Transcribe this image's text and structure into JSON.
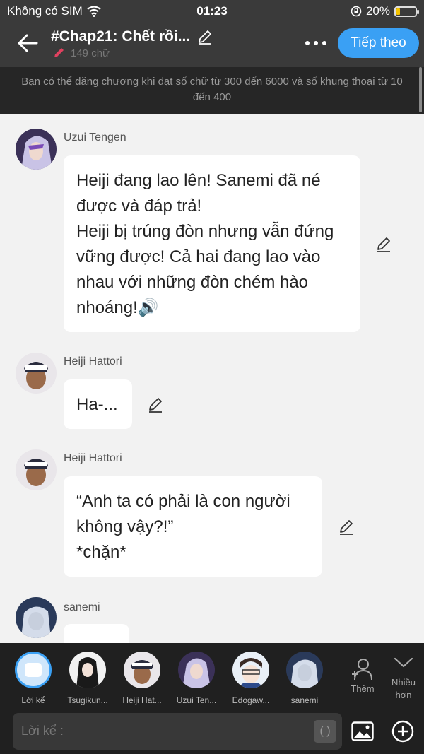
{
  "status_bar": {
    "carrier": "Không có SIM",
    "time": "01:23",
    "battery": "20%",
    "battery_level": 0.2
  },
  "header": {
    "title": "#Chap21: Chết rồi...",
    "word_count": "149 chữ",
    "next_label": "Tiếp theo"
  },
  "notice": "Bạn có thể đăng chương khi đạt số chữ từ 300 đến 6000 và số khung thoại từ 10 đến 400",
  "messages": [
    {
      "name": "Uzui Tengen",
      "text": "Heiji đang lao lên! Sanemi đã né được và đáp trả!\nHeiji bị trúng đòn nhưng vẫn đứng vững được! Cả hai đang lao vào nhau với những đòn chém hào nhoáng!🔊"
    },
    {
      "name": "Heiji Hattori",
      "text": "Ha-..."
    },
    {
      "name": "Heiji Hattori",
      "text": "“Anh ta có phải là con người không vậy?!”\n*chặn*"
    },
    {
      "name": "sanemi",
      "text": ""
    }
  ],
  "characters": [
    {
      "label": "Lời kể"
    },
    {
      "label": "Tsugikun..."
    },
    {
      "label": "Heiji Hat..."
    },
    {
      "label": "Uzui Ten..."
    },
    {
      "label": "Edogaw..."
    },
    {
      "label": "sanemi"
    }
  ],
  "add_label": "Thêm",
  "more_label": "Nhiều hơn",
  "input": {
    "placeholder": "Lời kể :",
    "paren": "( )"
  }
}
